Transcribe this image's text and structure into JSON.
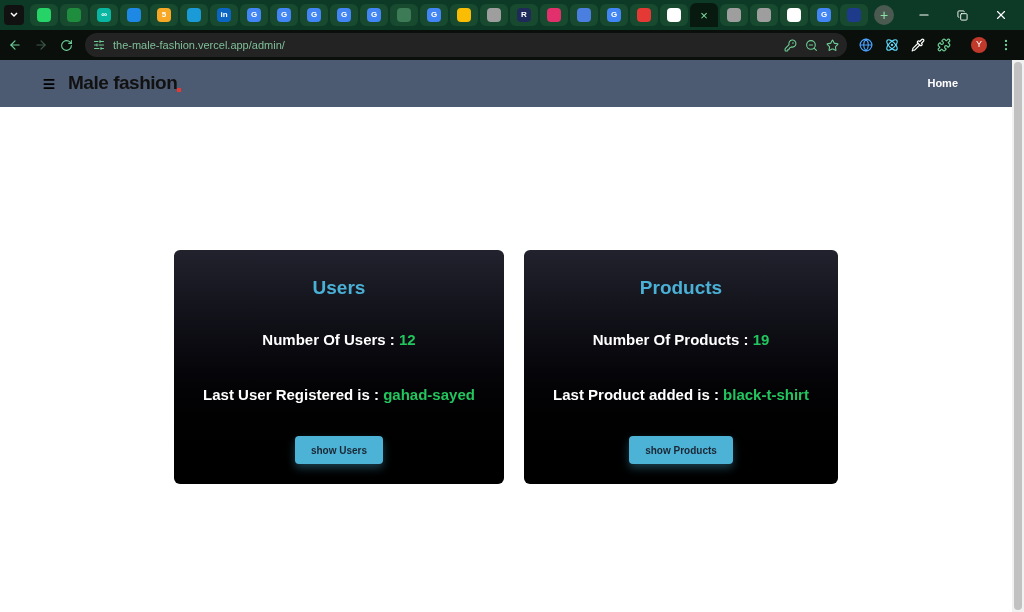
{
  "browser": {
    "tabs": [
      {
        "color": "#25d366",
        "selected": false
      },
      {
        "color": "#1e8e3e",
        "selected": false
      },
      {
        "color": "#09b6a2",
        "selected": false,
        "glyph": "∞"
      },
      {
        "color": "#1e88e5",
        "selected": false
      },
      {
        "color": "#f9a825",
        "selected": false,
        "glyph": "5"
      },
      {
        "color": "#1a9bd7",
        "selected": false
      },
      {
        "color": "#0a66c2",
        "selected": false,
        "glyph": "in"
      },
      {
        "color": "#4285f4",
        "selected": false,
        "glyph": "G"
      },
      {
        "color": "#4285f4",
        "selected": false,
        "glyph": "G"
      },
      {
        "color": "#4285f4",
        "selected": false,
        "glyph": "G"
      },
      {
        "color": "#4285f4",
        "selected": false,
        "glyph": "G"
      },
      {
        "color": "#4285f4",
        "selected": false,
        "glyph": "G"
      },
      {
        "color": "#3d7a56",
        "selected": false
      },
      {
        "color": "#4285f4",
        "selected": false,
        "glyph": "G"
      },
      {
        "color": "#fbbc04",
        "selected": false
      },
      {
        "color": "#9e9e9e",
        "selected": false
      },
      {
        "color": "#1f2a5a",
        "selected": false,
        "glyph": "R"
      },
      {
        "color": "#e1306c",
        "selected": false
      },
      {
        "color": "#4a7fe0",
        "selected": false
      },
      {
        "color": "#4285f4",
        "selected": false,
        "glyph": "G"
      },
      {
        "color": "#e53935",
        "selected": false
      },
      {
        "color": "#ffffff",
        "selected": false
      },
      {
        "selected": true,
        "glyph": "×"
      },
      {
        "color": "#9e9e9e",
        "selected": false
      },
      {
        "color": "#9e9e9e",
        "selected": false
      },
      {
        "color": "#ffffff",
        "selected": false
      },
      {
        "color": "#4285f4",
        "selected": false,
        "glyph": "G"
      },
      {
        "color": "#1e3a8a",
        "selected": false
      }
    ],
    "new_tab": "+",
    "url": "the-male-fashion.vercel.app/admin/",
    "profile": "Y"
  },
  "header": {
    "logo": "Male fashion",
    "nav": [
      "Home"
    ]
  },
  "cards": [
    {
      "title": "Users",
      "stats": [
        {
          "label": "Number Of Users :",
          "value": "12"
        },
        {
          "label": "Last User Registered is :",
          "value": "gahad-sayed"
        }
      ],
      "button": "show Users"
    },
    {
      "title": "Products",
      "stats": [
        {
          "label": "Number Of Products :",
          "value": "19"
        },
        {
          "label": "Last Product added is :",
          "value": "black-t-shirt"
        }
      ],
      "button": "show Products"
    }
  ]
}
